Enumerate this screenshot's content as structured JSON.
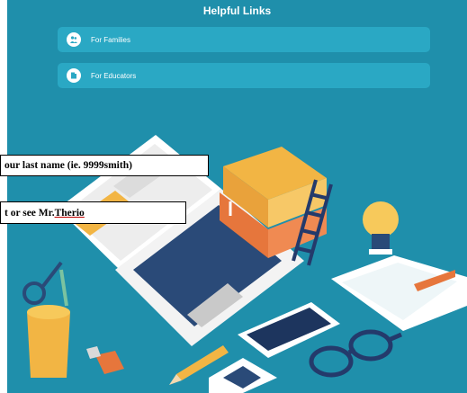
{
  "section": {
    "title": "Helpful Links"
  },
  "links": [
    {
      "label": "For Families",
      "icon": "people-icon"
    },
    {
      "label": "For Educators",
      "icon": "book-icon"
    }
  ],
  "overlays": {
    "line1": "our last name (ie. 9999smith)",
    "line2_prefix": "t or see Mr. ",
    "line2_name": "Therio"
  },
  "colors": {
    "background": "#1f8fab",
    "link_bg": "#2aa8c4"
  }
}
